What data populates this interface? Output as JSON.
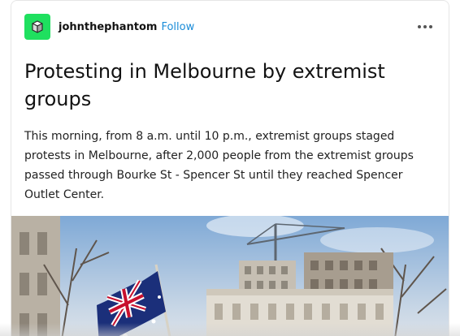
{
  "post": {
    "author": {
      "username": "johnthephantom",
      "avatar_icon": "cube-icon",
      "avatar_color": "#1fe05f"
    },
    "follow_label": "Follow",
    "menu_icon": "more-dots-icon",
    "title": "Protesting in Melbourne by extremist groups",
    "body": "This morning, from 8 a.m. until 10 p.m., extremist groups staged protests in Melbourne, after 2,000 people from the extremist groups passed through Bourke St - Spencer St until they reached Spencer Outlet Center."
  },
  "colors": {
    "accent": "#1a8cd8",
    "text": "#121212"
  }
}
